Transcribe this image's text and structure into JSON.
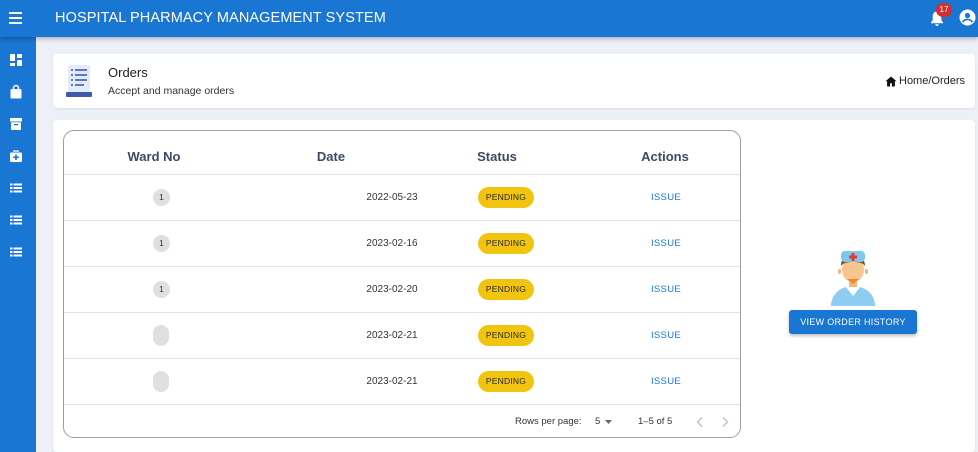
{
  "app": {
    "title": "HOSPITAL PHARMACY MANAGEMENT SYSTEM",
    "notification_count": "17",
    "accent_color": "#1976d2"
  },
  "sidebar": {
    "items": [
      {
        "icon": "dashboard-icon"
      },
      {
        "icon": "shopping-bag-icon"
      },
      {
        "icon": "archive-icon"
      },
      {
        "icon": "medical-bag-icon"
      },
      {
        "icon": "list-icon"
      },
      {
        "icon": "list-icon"
      },
      {
        "icon": "list-icon"
      }
    ]
  },
  "header": {
    "title": "Orders",
    "subtitle": "Accept and manage orders",
    "breadcrumb": "Home/Orders"
  },
  "table": {
    "columns": [
      "Ward No",
      "Date",
      "Status",
      "Actions"
    ],
    "rows": [
      {
        "ward": "1",
        "date": "2022-05-23",
        "status": "PENDING",
        "action": "ISSUE"
      },
      {
        "ward": "1",
        "date": "2023-02-16",
        "status": "PENDING",
        "action": "ISSUE"
      },
      {
        "ward": "1",
        "date": "2023-02-20",
        "status": "PENDING",
        "action": "ISSUE"
      },
      {
        "ward": "",
        "date": "2023-02-21",
        "status": "PENDING",
        "action": "ISSUE"
      },
      {
        "ward": "",
        "date": "2023-02-21",
        "status": "PENDING",
        "action": "ISSUE"
      }
    ],
    "status_color": "#f1c40f"
  },
  "pagination": {
    "rows_per_page_label": "Rows per page:",
    "rows_per_page_value": "5",
    "range": "1–5 of 5"
  },
  "side_panel": {
    "button_label": "VIEW ORDER HISTORY"
  }
}
